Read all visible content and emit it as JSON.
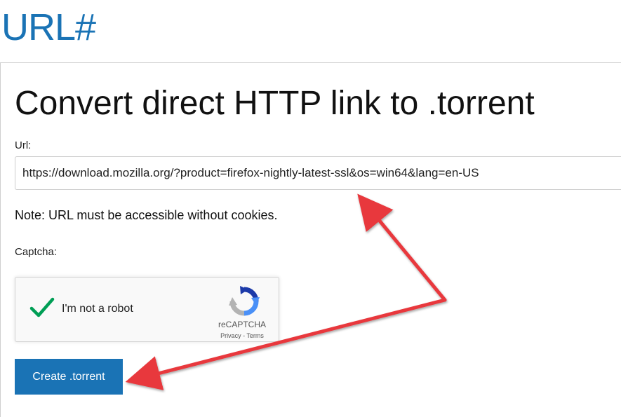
{
  "site": {
    "logo": "URL#"
  },
  "main": {
    "heading": "Convert direct HTTP link to .torrent",
    "url_label": "Url:",
    "url_value": "https://download.mozilla.org/?product=firefox-nightly-latest-ssl&os=win64&lang=en-US",
    "note": "Note: URL must be accessible without cookies.",
    "captcha_label": "Captcha:",
    "submit_label": "Create .torrent"
  },
  "recaptcha": {
    "label": "I'm not a robot",
    "checked": true,
    "brand": "reCAPTCHA",
    "privacy": "Privacy",
    "separator": " - ",
    "terms": "Terms"
  },
  "colors": {
    "brand_blue": "#1a73b5",
    "arrow_red": "#e8383d",
    "check_green": "#009e55"
  },
  "annotations": {
    "arrow_color": "#e8383d"
  }
}
